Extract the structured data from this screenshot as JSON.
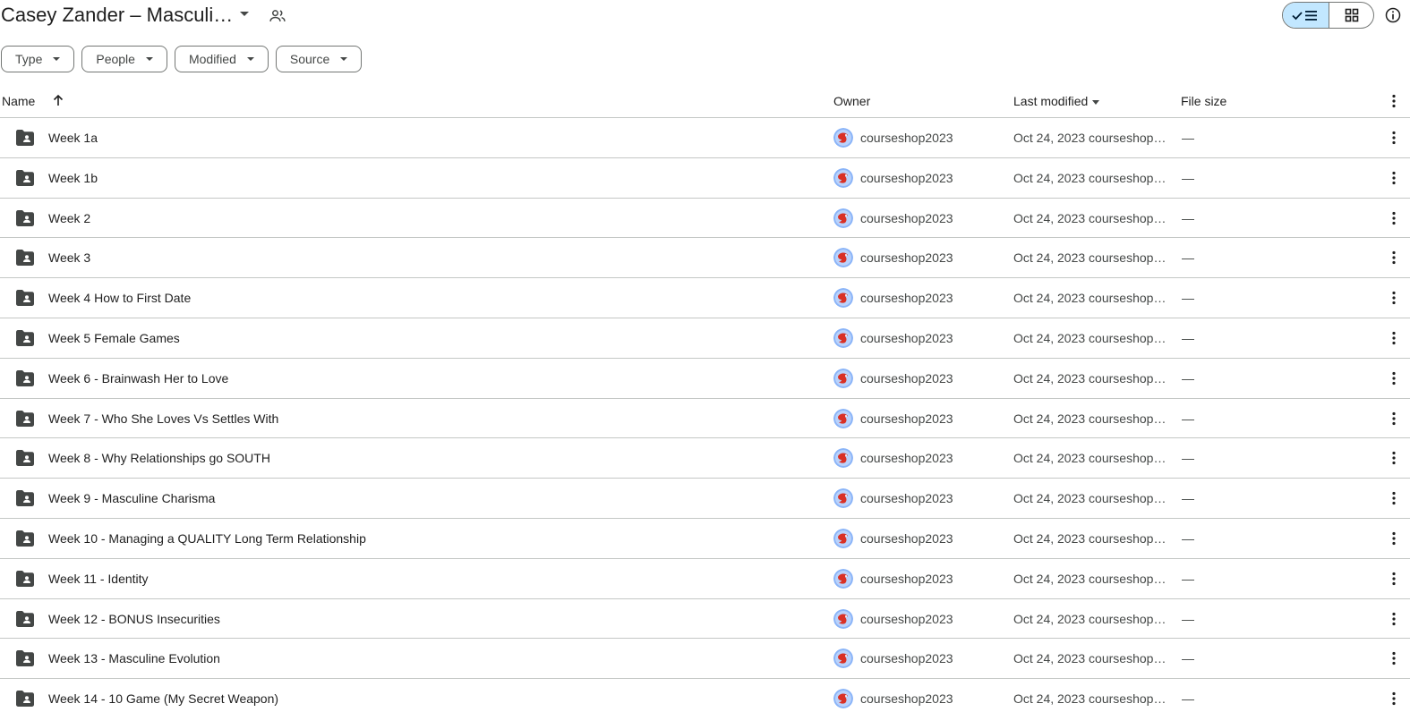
{
  "header": {
    "title": "Casey Zander – Masculi…",
    "title_menu_icon": "caret-down-icon",
    "share_icon": "people-icon",
    "view_list_icon": "check-list-icon",
    "view_grid_icon": "grid-icon",
    "info_icon": "info-icon"
  },
  "filters": [
    {
      "label": "Type"
    },
    {
      "label": "People"
    },
    {
      "label": "Modified"
    },
    {
      "label": "Source"
    }
  ],
  "table": {
    "columns": {
      "name": "Name",
      "owner": "Owner",
      "last_modified": "Last modified",
      "file_size": "File size"
    },
    "rows": [
      {
        "name": "Week 1a",
        "owner": "courseshop2023",
        "modified": "Oct 24, 2023 courseshop2023",
        "size": "—"
      },
      {
        "name": "Week 1b",
        "owner": "courseshop2023",
        "modified": "Oct 24, 2023 courseshop2023",
        "size": "—"
      },
      {
        "name": "Week 2",
        "owner": "courseshop2023",
        "modified": "Oct 24, 2023 courseshop2023",
        "size": "—"
      },
      {
        "name": "Week 3",
        "owner": "courseshop2023",
        "modified": "Oct 24, 2023 courseshop2023",
        "size": "—"
      },
      {
        "name": "Week 4 How to First Date",
        "owner": "courseshop2023",
        "modified": "Oct 24, 2023 courseshop2023",
        "size": "—"
      },
      {
        "name": "Week 5 Female Games",
        "owner": "courseshop2023",
        "modified": "Oct 24, 2023 courseshop2023",
        "size": "—"
      },
      {
        "name": "Week 6 - Brainwash Her to Love",
        "owner": "courseshop2023",
        "modified": "Oct 24, 2023 courseshop2023",
        "size": "—"
      },
      {
        "name": "Week 7 - Who She Loves Vs Settles With",
        "owner": "courseshop2023",
        "modified": "Oct 24, 2023 courseshop2023",
        "size": "—"
      },
      {
        "name": "Week 8 - Why Relationships go SOUTH",
        "owner": "courseshop2023",
        "modified": "Oct 24, 2023 courseshop2023",
        "size": "—"
      },
      {
        "name": "Week 9 - Masculine Charisma",
        "owner": "courseshop2023",
        "modified": "Oct 24, 2023 courseshop2023",
        "size": "—"
      },
      {
        "name": "Week 10 - Managing a QUALITY Long Term Relationship",
        "owner": "courseshop2023",
        "modified": "Oct 24, 2023 courseshop2023",
        "size": "—"
      },
      {
        "name": "Week 11 - Identity",
        "owner": "courseshop2023",
        "modified": "Oct 24, 2023 courseshop2023",
        "size": "—"
      },
      {
        "name": "Week 12 - BONUS Insecurities",
        "owner": "courseshop2023",
        "modified": "Oct 24, 2023 courseshop2023",
        "size": "—"
      },
      {
        "name": "Week 13 - Masculine Evolution",
        "owner": "courseshop2023",
        "modified": "Oct 24, 2023 courseshop2023",
        "size": "—"
      },
      {
        "name": "Week 14 - 10 Game (My Secret Weapon)",
        "owner": "courseshop2023",
        "modified": "Oct 24, 2023 courseshop2023",
        "size": "—"
      }
    ]
  },
  "colors": {
    "accent_selected": "#c2e7ff",
    "divider": "#c4c7c5",
    "icon": "#444746",
    "avatar_bg": "#8ab4f8",
    "avatar_fg": "#d93025"
  }
}
